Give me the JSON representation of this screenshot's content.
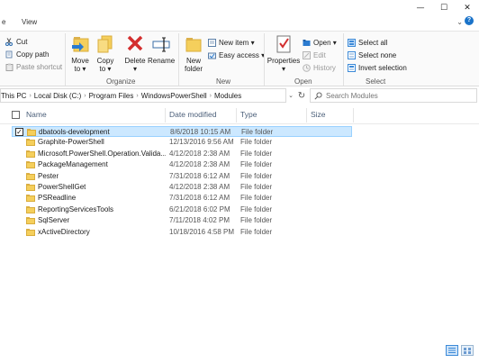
{
  "window": {
    "minimize_glyph": "—",
    "maximize_glyph": "☐",
    "close_glyph": "✕"
  },
  "tabs": [
    {
      "label": "e"
    },
    {
      "label": "View"
    }
  ],
  "ribbon": {
    "clipboard": {
      "cut": "Cut",
      "copy_path": "Copy path",
      "paste_shortcut": "Paste shortcut"
    },
    "organize": {
      "label": "Organize",
      "move_to": "Move\nto ▾",
      "move_to_line1": "Move",
      "move_to_line2": "to ▾",
      "copy_to_line1": "Copy",
      "copy_to_line2": "to ▾",
      "delete": "Delete",
      "delete_line2": "▾",
      "rename": "Rename"
    },
    "new": {
      "label": "New",
      "new_folder_line1": "New",
      "new_folder_line2": "folder",
      "new_item": "New item ▾",
      "easy_access": "Easy access ▾"
    },
    "open": {
      "label": "Open",
      "properties": "Properties",
      "properties_line2": "▾",
      "open": "Open ▾",
      "edit": "Edit",
      "history": "History"
    },
    "select": {
      "label": "Select",
      "select_all": "Select all",
      "select_none": "Select none",
      "invert_selection": "Invert selection"
    }
  },
  "address": {
    "crumbs": [
      "This PC",
      "Local Disk (C:)",
      "Program Files",
      "WindowsPowerShell",
      "Modules"
    ],
    "search_placeholder": "Search Modules"
  },
  "columns": {
    "name": "Name",
    "date_modified": "Date modified",
    "type": "Type",
    "size": "Size"
  },
  "files": [
    {
      "name": "dbatools-development",
      "date": "8/6/2018 10:15 AM",
      "type": "File folder",
      "selected": true
    },
    {
      "name": "Graphite-PowerShell",
      "date": "12/13/2016 9:56 AM",
      "type": "File folder",
      "selected": false
    },
    {
      "name": "Microsoft.PowerShell.Operation.Valida...",
      "date": "4/12/2018 2:38 AM",
      "type": "File folder",
      "selected": false
    },
    {
      "name": "PackageManagement",
      "date": "4/12/2018 2:38 AM",
      "type": "File folder",
      "selected": false
    },
    {
      "name": "Pester",
      "date": "7/31/2018 6:12 AM",
      "type": "File folder",
      "selected": false
    },
    {
      "name": "PowerShellGet",
      "date": "4/12/2018 2:38 AM",
      "type": "File folder",
      "selected": false
    },
    {
      "name": "PSReadline",
      "date": "7/31/2018 6:12 AM",
      "type": "File folder",
      "selected": false
    },
    {
      "name": "ReportingServicesTools",
      "date": "6/21/2018 6:02 PM",
      "type": "File folder",
      "selected": false
    },
    {
      "name": "SqlServer",
      "date": "7/11/2018 4:02 PM",
      "type": "File folder",
      "selected": false
    },
    {
      "name": "xActiveDirectory",
      "date": "10/18/2016 4:58 PM",
      "type": "File folder",
      "selected": false
    }
  ],
  "colors": {
    "accent": "#0078d7",
    "selection_bg": "#cce8ff",
    "selection_border": "#99d1ff",
    "folder": "#f5cf5c",
    "delete_red": "#d32f2f"
  }
}
